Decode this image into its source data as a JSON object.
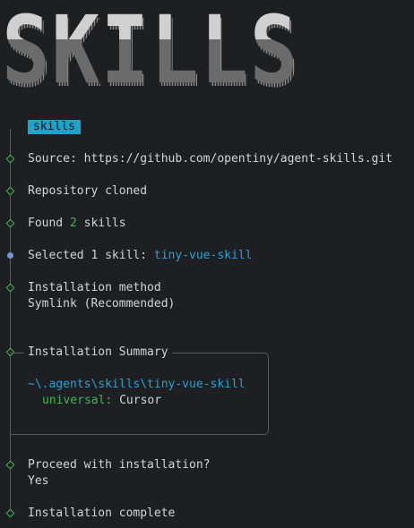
{
  "banner": {
    "text": "SKILLS"
  },
  "badge": "skills",
  "steps": {
    "source_label": "Source:",
    "source_url": "https://github.com/opentiny/agent-skills.git",
    "repo_cloned": "Repository cloned",
    "found_prefix": "Found",
    "found_count": "2",
    "found_suffix": "skills",
    "selected_prefix": "Selected 1 skill:",
    "selected_skill": "tiny-vue-skill",
    "method_title": "Installation method",
    "method_value": "Symlink (Recommended)",
    "summary_title": "Installation Summary",
    "summary_path": "~\\.agents\\skills\\tiny-vue-skill",
    "summary_key": "universal:",
    "summary_value": "Cursor",
    "proceed_q": "Proceed with installation?",
    "proceed_a": "Yes",
    "complete": "Installation complete"
  },
  "colors": {
    "accent_cyan": "#2aa1d3",
    "success_green": "#3fb950",
    "active_dot": "#6e96d6",
    "badge_bg": "#1fa2c9"
  },
  "icons": {
    "done": "diamond-outline-icon",
    "active": "filled-dot-icon"
  }
}
